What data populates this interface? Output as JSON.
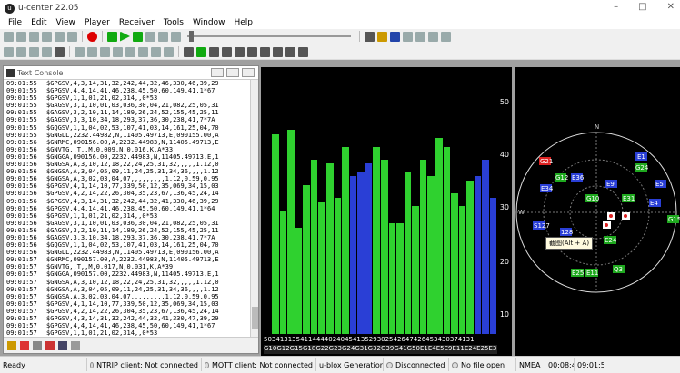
{
  "window": {
    "title": "u-center 22.05",
    "minimize": "–",
    "maximize": "□",
    "close": "✕"
  },
  "menu": [
    "File",
    "Edit",
    "View",
    "Player",
    "Receiver",
    "Tools",
    "Window",
    "Help"
  ],
  "console": {
    "title": "Text Console",
    "lines": [
      [
        "09:01:55",
        "$GPGSV,4,3,14,31,32,242,44,32,46,330,46,39,29"
      ],
      [
        "09:01:55",
        "$GPGSV,4,4,14,41,46,238,45,50,60,149,41,1*67"
      ],
      [
        "09:01:55",
        "$GPGSV,1,1,01,21,02,314,,0*53"
      ],
      [
        "09:01:55",
        "$GAGSV,3,1,10,01,03,036,30,04,21,082,25,05,31"
      ],
      [
        "09:01:55",
        "$GAGSV,3,2,10,11,14,189,26,24,52,155,45,25,11"
      ],
      [
        "09:01:55",
        "$GAGSV,3,3,10,34,18,293,37,36,30,238,41,7*7A"
      ],
      [
        "09:01:55",
        "$GQGSV,1,1,04,02,53,107,41,03,14,161,25,04,70"
      ],
      [
        "09:01:55",
        "$GNGLL,2232.44982,N,11405.49713,E,090155.00,A"
      ],
      [
        "09:01:56",
        "$GNRMC,090156.00,A,2232.44983,N,11405.49713,E"
      ],
      [
        "09:01:56",
        "$GNVTG,,T,,M,0.009,N,0.016,K,A*33"
      ],
      [
        "09:01:56",
        "$GNGGA,090156.00,2232.44983,N,11405.49713,E,1"
      ],
      [
        "09:01:56",
        "$GNGSA,A,3,10,12,18,22,24,25,31,32,,,,,1.12,0"
      ],
      [
        "09:01:56",
        "$GNGSA,A,3,04,05,09,11,24,25,31,34,36,,,,1.12"
      ],
      [
        "09:01:56",
        "$GNGSA,A,3,02,03,04,07,,,,,,,,,1.12,0.59,0.95"
      ],
      [
        "09:01:56",
        "$GPGSV,4,1,14,10,77,339,50,12,35,069,34,15,03"
      ],
      [
        "09:01:56",
        "$GPGSV,4,2,14,22,26,304,35,23,67,136,45,24,14"
      ],
      [
        "09:01:56",
        "$GPGSV,4,3,14,31,32,242,44,32,41,330,46,39,29"
      ],
      [
        "09:01:56",
        "$GPGSV,4,4,14,41,46,238,45,50,60,149,41,1*64"
      ],
      [
        "09:01:56",
        "$GPGSV,1,1,01,21,02,314,,0*53"
      ],
      [
        "09:01:56",
        "$GAGSV,3,1,10,01,03,036,30,04,21,082,25,05,31"
      ],
      [
        "09:01:56",
        "$GAGSV,3,2,10,11,14,189,26,24,52,155,45,25,11"
      ],
      [
        "09:01:56",
        "$GAGSV,3,3,10,34,18,293,37,36,30,238,41,7*7A"
      ],
      [
        "09:01:56",
        "$GQGSV,1,1,04,02,53,107,41,03,14,161,25,04,70"
      ],
      [
        "09:01:56",
        "$GNGLL,2232.44983,N,11405.49713,E,090156.00,A"
      ],
      [
        "09:01:57",
        "$GNRMC,090157.00,A,2232.44983,N,11405.49713,E"
      ],
      [
        "09:01:57",
        "$GNVTG,,T,,M,0.017,N,0.031,K,A*39"
      ],
      [
        "09:01:57",
        "$GNGGA,090157.00,2232.44983,N,11405.49713,E,1"
      ],
      [
        "09:01:57",
        "$GNGSA,A,3,10,12,18,22,24,25,31,32,,,,,1.12,0"
      ],
      [
        "09:01:57",
        "$GNGSA,A,3,04,05,09,11,24,25,31,34,36,,,,1.12"
      ],
      [
        "09:01:57",
        "$GNGSA,A,3,02,03,04,07,,,,,,,,,1.12,0.59,0.95"
      ],
      [
        "09:01:57",
        "$GPGSV,4,1,14,10,77,339,50,12,35,069,34,15,03"
      ],
      [
        "09:01:57",
        "$GPGSV,4,2,14,22,26,304,35,23,67,136,45,24,14"
      ],
      [
        "09:01:57",
        "$GPGSV,4,3,14,31,32,242,44,32,41,330,47,39,29"
      ],
      [
        "09:01:57",
        "$GPGSV,4,4,14,41,46,238,45,50,60,149,41,1*67"
      ],
      [
        "09:01:57",
        "$GPGSV,1,1,01,21,02,314,,0*53"
      ],
      [
        "09:01:57",
        "$GAGSV,3,1,10,01,03,036,29,04,21,082,25,05,31"
      ]
    ]
  },
  "chart_data": {
    "type": "bar",
    "ylim": [
      0,
      55
    ],
    "yticks": [
      "50",
      "40",
      "30",
      "20",
      "10"
    ],
    "bars": [
      {
        "v": 0,
        "c": "w"
      },
      {
        "v": 47,
        "c": "g"
      },
      {
        "v": 29,
        "c": "g"
      },
      {
        "v": 48,
        "c": "g"
      },
      {
        "v": 25,
        "c": "g"
      },
      {
        "v": 35,
        "c": "g"
      },
      {
        "v": 41,
        "c": "g"
      },
      {
        "v": 31,
        "c": "g"
      },
      {
        "v": 40,
        "c": "g"
      },
      {
        "v": 32,
        "c": "g"
      },
      {
        "v": 44,
        "c": "g"
      },
      {
        "v": 37,
        "c": "b"
      },
      {
        "v": 38,
        "c": "b"
      },
      {
        "v": 40,
        "c": "b"
      },
      {
        "v": 44,
        "c": "g"
      },
      {
        "v": 41,
        "c": "g"
      },
      {
        "v": 26,
        "c": "g"
      },
      {
        "v": 26,
        "c": "g"
      },
      {
        "v": 38,
        "c": "g"
      },
      {
        "v": 30,
        "c": "g"
      },
      {
        "v": 41,
        "c": "g"
      },
      {
        "v": 37,
        "c": "g"
      },
      {
        "v": 46,
        "c": "g"
      },
      {
        "v": 44,
        "c": "g"
      },
      {
        "v": 33,
        "c": "g"
      },
      {
        "v": 30,
        "c": "g"
      },
      {
        "v": 36,
        "c": "g"
      },
      {
        "v": 37,
        "c": "b"
      },
      {
        "v": 41,
        "c": "b"
      },
      {
        "v": 32,
        "c": "b"
      }
    ],
    "cn0_row": "5034131354114444024045413529302542647426453430374131",
    "svid_row": "G10G12G15G18G22G23G24G31G32G39G41G50E1E4E5E9E11E24E25E31E34E36Q2Q3Q4Q7"
  },
  "tooltip": "截图(Alt + A)",
  "status": {
    "ready": "Ready",
    "ntrip": "NTRIP client: Not connected",
    "mqtt": "MQTT client: Not connected",
    "gen": "u-blox Generation 9",
    "disconnected": "Disconnected",
    "file": "No file open",
    "nmea": "NMEA",
    "time1": "00:08:4",
    "time2": "09:01:5"
  }
}
